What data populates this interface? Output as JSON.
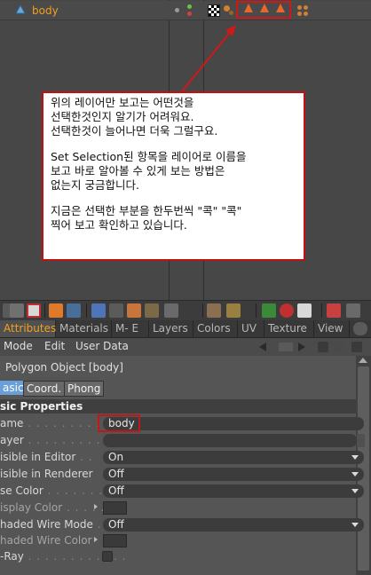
{
  "object_manager": {
    "object_name": "body",
    "callout": {
      "paragraph1": "위의 레이어만 보고는 어떤것을\n선택한것인지 알기가 어려워요.\n선택한것이 늘어나면 더욱 그럴구요.",
      "paragraph2": "Set Selection된 항목을 레이어로 이름을\n보고 바로 알아볼 수 있게 보는 방법은\n없는지 궁금합니다.",
      "paragraph3": "지금은 선택한 부분을 한두번씩 \"콕\" \"콕\"\n찍어 보고 확인하고 있습니다."
    }
  },
  "tabs": [
    "Attributes",
    "Materials",
    "M- E",
    "Layers",
    "Colors",
    "UV",
    "Texture",
    "View"
  ],
  "menu": [
    "Mode",
    "Edit",
    "User Data"
  ],
  "object_title": "Polygon Object [body]",
  "subtabs": [
    "asic",
    "Coord.",
    "Phong"
  ],
  "section_title": "sic Properties",
  "properties": {
    "name": {
      "label": "ame",
      "value": "body"
    },
    "layer": {
      "label": "ayer",
      "value": ""
    },
    "visible_editor": {
      "label": "isible in Editor",
      "value": "On"
    },
    "visible_renderer": {
      "label": "isible in Renderer",
      "value": "Off"
    },
    "use_color": {
      "label": "se Color",
      "value": "Off"
    },
    "display_color": {
      "label": "isplay Color"
    },
    "shaded_wire_mode": {
      "label": "haded Wire Mode",
      "value": "Off"
    },
    "shaded_wire_color": {
      "label": "haded Wire Color"
    },
    "xray": {
      "label": "-Ray"
    }
  },
  "colors": {
    "accent": "#f0a020",
    "highlight_red": "#d01818"
  }
}
